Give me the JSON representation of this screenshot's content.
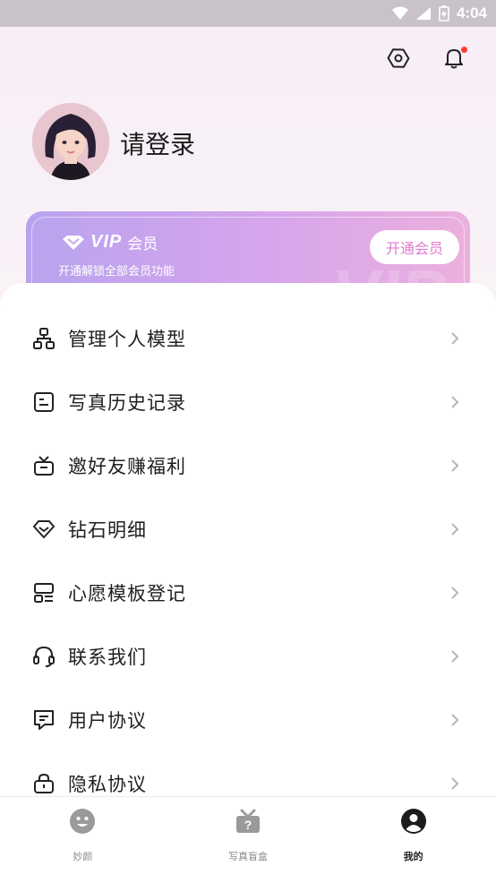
{
  "status_bar": {
    "time": "4:04"
  },
  "profile": {
    "title": "请登录"
  },
  "vip": {
    "label": "会员",
    "logo_text": "VIP",
    "subtitle": "开通解锁全部会员功能",
    "button": "开通会员"
  },
  "menu": [
    {
      "label": "管理个人模型",
      "icon": "hierarchy-icon"
    },
    {
      "label": "写真历史记录",
      "icon": "history-card-icon"
    },
    {
      "label": "邀好友赚福利",
      "icon": "gift-box-icon"
    },
    {
      "label": "钻石明细",
      "icon": "diamond-icon"
    },
    {
      "label": "心愿模板登记",
      "icon": "template-icon"
    },
    {
      "label": "联系我们",
      "icon": "headset-icon"
    },
    {
      "label": "用户协议",
      "icon": "agreement-icon"
    },
    {
      "label": "隐私协议",
      "icon": "lock-icon"
    }
  ],
  "tabs": [
    {
      "label": "妙颜",
      "icon": "smile-icon",
      "active": false
    },
    {
      "label": "写真盲盒",
      "icon": "mystery-box-icon",
      "active": false
    },
    {
      "label": "我的",
      "icon": "user-icon",
      "active": true
    }
  ]
}
